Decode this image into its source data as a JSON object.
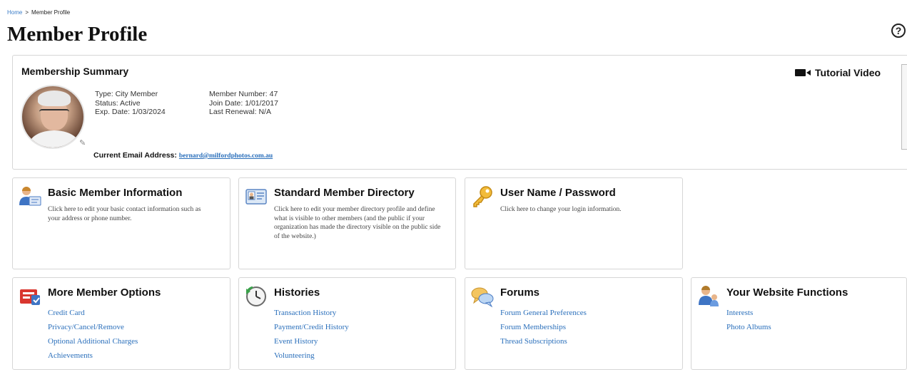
{
  "breadcrumb": {
    "home": "Home",
    "separator": ">",
    "current": "Member Profile"
  },
  "page_title": "Member Profile",
  "help_icon": {
    "glyph": "?"
  },
  "summary": {
    "heading": "Membership Summary",
    "tutorial_label": "Tutorial Video",
    "type": "Type: City Member",
    "status": "Status: Active",
    "exp_date": "Exp. Date: 1/03/2024",
    "member_number": "Member Number: 47",
    "join_date": "Join Date: 1/01/2017",
    "last_renewal": "Last Renewal: N/A",
    "email_label": "Current Email Address:",
    "email": "bernard@milfordphotos.com.au"
  },
  "cards": {
    "basic_info": {
      "title": "Basic Member Information",
      "desc": "Click here to edit your basic contact information such as your address or phone number."
    },
    "directory": {
      "title": "Standard Member Directory",
      "desc": "Click here to edit your member directory profile and define what is visible to other members (and the public if your organization has made the directory visible on the public side of the website.)"
    },
    "password": {
      "title": "User Name / Password",
      "desc": "Click here to change your login information."
    },
    "more_options": {
      "title": "More Member Options",
      "links": [
        "Credit Card",
        "Privacy/Cancel/Remove",
        "Optional Additional Charges",
        "Achievements"
      ]
    },
    "histories": {
      "title": "Histories",
      "links": [
        "Transaction History",
        "Payment/Credit History",
        "Event History",
        "Volunteering"
      ]
    },
    "forums": {
      "title": "Forums",
      "links": [
        "Forum General Preferences",
        "Forum Memberships",
        "Thread Subscriptions"
      ]
    },
    "website_functions": {
      "title": "Your Website Functions",
      "links": [
        "Interests",
        "Photo Albums"
      ]
    }
  },
  "colors": {
    "link": "#2a6fbb",
    "border": "#d6d6d6"
  },
  "icons": [
    "help-icon",
    "video-camera-icon",
    "pencil-icon",
    "user-card-icon",
    "directory-icon",
    "key-icon",
    "options-icon",
    "clock-icon",
    "chat-bubbles-icon",
    "users-icon"
  ]
}
